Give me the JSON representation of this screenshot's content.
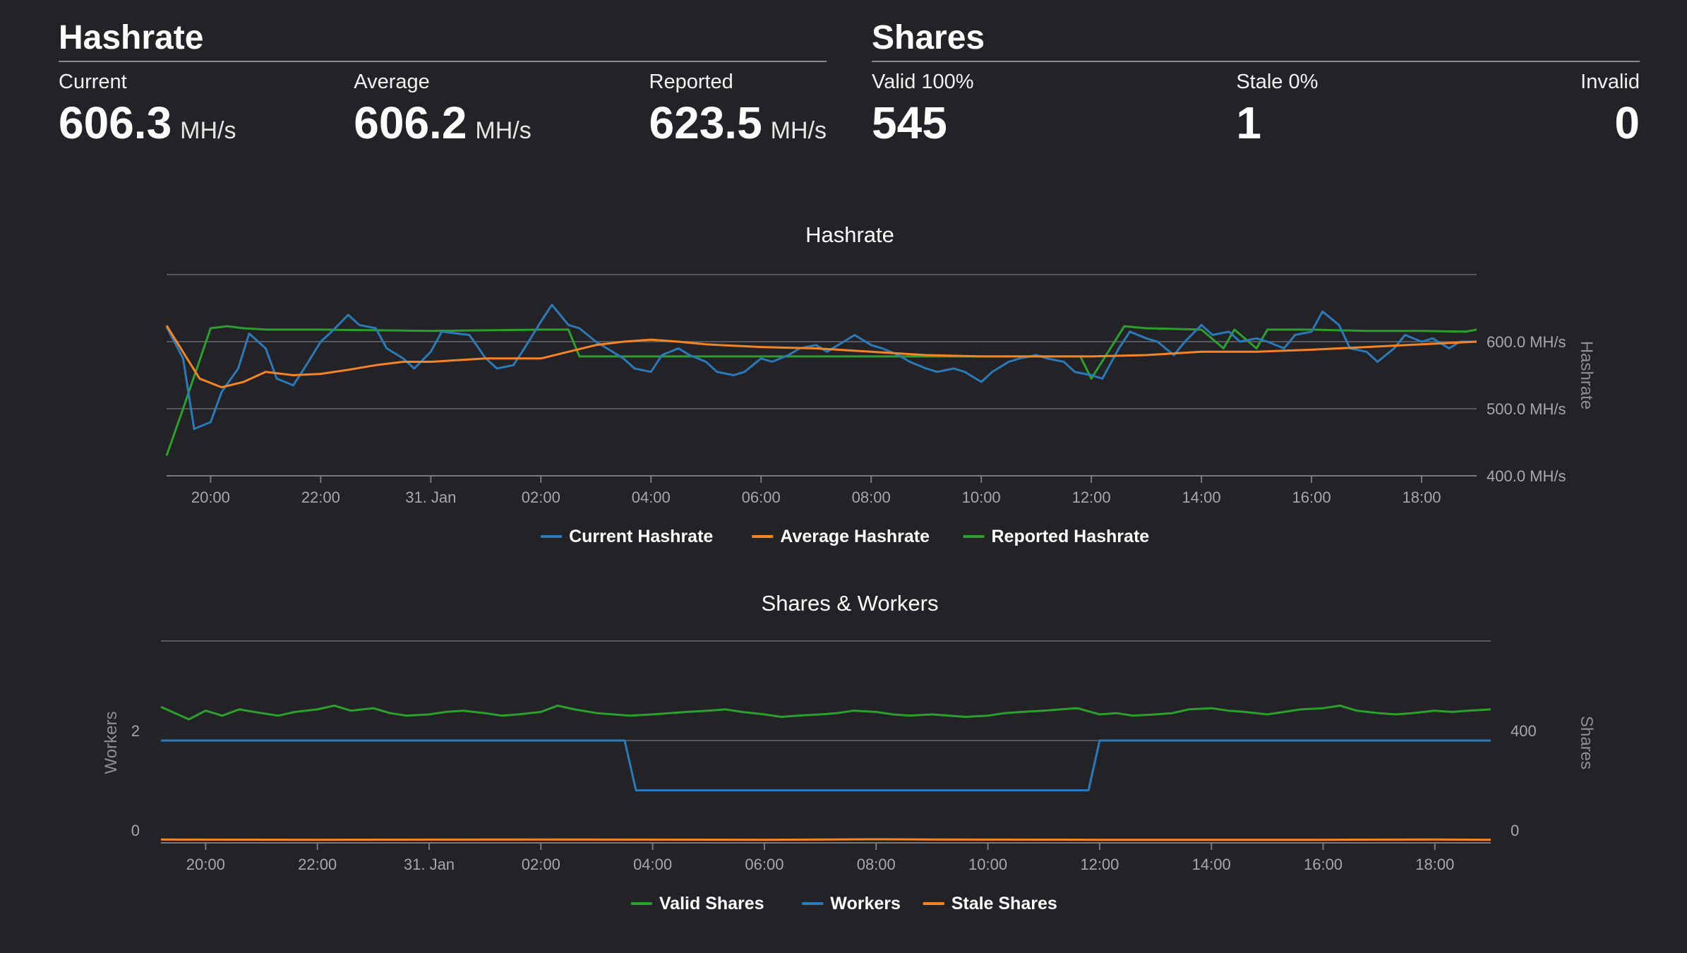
{
  "hashrate": {
    "title": "Hashrate",
    "current": {
      "label": "Current",
      "value": "606.3",
      "unit": "MH/s"
    },
    "average": {
      "label": "Average",
      "value": "606.2",
      "unit": "MH/s"
    },
    "reported": {
      "label": "Reported",
      "value": "623.5",
      "unit": "MH/s"
    }
  },
  "shares": {
    "title": "Shares",
    "valid": {
      "label": "Valid 100%",
      "value": "545"
    },
    "stale": {
      "label": "Stale 0%",
      "value": "1"
    },
    "invalid": {
      "label": "Invalid",
      "value": "0"
    }
  },
  "colors": {
    "blue": "#2a7ab9",
    "orange": "#f58422",
    "green": "#2ca02c"
  },
  "chart_data": [
    {
      "type": "line",
      "title": "Hashrate",
      "ylabel": "Hashrate",
      "ylim": [
        400,
        700
      ],
      "yticks": [
        "400.0 MH/s",
        "500.0 MH/s",
        "600.0 MH/s"
      ],
      "x_tick_labels": [
        "20:00",
        "22:00",
        "31. Jan",
        "02:00",
        "04:00",
        "06:00",
        "08:00",
        "10:00",
        "12:00",
        "14:00",
        "16:00",
        "18:00"
      ],
      "x_range_hours": [
        19.2,
        43.0
      ],
      "grid": true,
      "legend_position": "bottom",
      "series": [
        {
          "name": "Current Hashrate",
          "color": "#2a7ab9",
          "x": [
            19.2,
            19.5,
            19.7,
            20.0,
            20.2,
            20.5,
            20.7,
            21.0,
            21.2,
            21.5,
            21.7,
            22.0,
            22.2,
            22.5,
            22.7,
            23.0,
            23.2,
            23.5,
            23.7,
            24.0,
            24.2,
            24.5,
            24.7,
            25.0,
            25.2,
            25.5,
            25.7,
            26.0,
            26.2,
            26.5,
            26.7,
            27.0,
            27.2,
            27.5,
            27.7,
            28.0,
            28.2,
            28.5,
            28.7,
            29.0,
            29.2,
            29.5,
            29.7,
            30.0,
            30.2,
            30.5,
            30.7,
            31.0,
            31.2,
            31.5,
            31.7,
            32.0,
            32.2,
            32.5,
            32.7,
            33.0,
            33.2,
            33.5,
            33.7,
            34.0,
            34.2,
            34.5,
            34.7,
            35.0,
            35.2,
            35.5,
            35.7,
            36.0,
            36.2,
            36.5,
            36.7,
            37.0,
            37.2,
            37.5,
            37.7,
            38.0,
            38.2,
            38.5,
            38.7,
            39.0,
            39.2,
            39.5,
            39.7,
            40.0,
            40.2,
            40.5,
            40.7,
            41.0,
            41.2,
            41.5,
            41.7,
            42.0,
            42.2,
            42.5,
            42.7,
            43.0
          ],
          "y": [
            622,
            575,
            470,
            480,
            525,
            560,
            612,
            590,
            545,
            535,
            560,
            600,
            615,
            640,
            625,
            620,
            590,
            575,
            560,
            585,
            615,
            612,
            610,
            575,
            560,
            565,
            590,
            630,
            655,
            625,
            620,
            600,
            590,
            575,
            560,
            555,
            580,
            590,
            580,
            570,
            555,
            550,
            555,
            575,
            570,
            580,
            590,
            595,
            585,
            600,
            610,
            595,
            590,
            580,
            570,
            560,
            555,
            560,
            555,
            540,
            555,
            570,
            575,
            580,
            575,
            570,
            555,
            550,
            545,
            590,
            615,
            605,
            600,
            580,
            600,
            625,
            610,
            615,
            600,
            605,
            600,
            590,
            610,
            615,
            645,
            625,
            590,
            585,
            570,
            590,
            610,
            600,
            605,
            590,
            600,
            600
          ],
          "note_unused": ""
        },
        {
          "name": "Average Hashrate",
          "color": "#f58422",
          "x": [
            19.2,
            19.8,
            20.2,
            20.6,
            21.0,
            21.5,
            22.0,
            22.5,
            23.0,
            23.5,
            24.0,
            25.0,
            26.0,
            26.5,
            27.0,
            27.5,
            28.0,
            28.5,
            29.0,
            30.0,
            31.0,
            32.0,
            33.0,
            34.0,
            35.0,
            36.0,
            37.0,
            38.0,
            39.0,
            40.0,
            41.0,
            42.0,
            43.0
          ],
          "y": [
            624,
            545,
            532,
            540,
            555,
            550,
            552,
            558,
            565,
            570,
            570,
            575,
            575,
            585,
            595,
            600,
            603,
            600,
            596,
            592,
            590,
            585,
            580,
            578,
            578,
            578,
            580,
            585,
            585,
            588,
            592,
            596,
            600
          ]
        },
        {
          "name": "Reported Hashrate",
          "color": "#2ca02c",
          "x": [
            19.2,
            19.5,
            20.0,
            20.3,
            20.6,
            21.0,
            22.0,
            24.0,
            26.0,
            26.5,
            26.7,
            28.0,
            30.0,
            32.0,
            35.0,
            35.8,
            36.0,
            36.6,
            37.0,
            38.0,
            38.4,
            38.6,
            39.0,
            39.2,
            39.5,
            40.0,
            41.0,
            42.0,
            42.8,
            43.0
          ],
          "y": [
            430,
            500,
            620,
            623,
            620,
            618,
            618,
            616,
            618,
            618,
            578,
            578,
            578,
            578,
            578,
            578,
            545,
            623,
            620,
            618,
            590,
            618,
            590,
            618,
            618,
            618,
            616,
            616,
            615,
            618
          ]
        }
      ]
    },
    {
      "type": "line",
      "title": "Shares & Workers",
      "ylabel_left": "Workers",
      "ylabel_right": "Shares",
      "yticks_left": [
        "0",
        "2"
      ],
      "yticks_right": [
        "0",
        "400"
      ],
      "x_tick_labels": [
        "20:00",
        "22:00",
        "31. Jan",
        "02:00",
        "04:00",
        "06:00",
        "08:00",
        "10:00",
        "12:00",
        "14:00",
        "16:00",
        "18:00"
      ],
      "x_range_hours": [
        19.2,
        43.0
      ],
      "grid": true,
      "legend_position": "bottom",
      "series": [
        {
          "name": "Valid Shares",
          "color": "#2ca02c",
          "axis": "right",
          "x": [
            19.2,
            19.7,
            20.0,
            20.3,
            20.6,
            21.0,
            21.3,
            21.6,
            22.0,
            22.3,
            22.6,
            23.0,
            23.3,
            23.6,
            24.0,
            24.3,
            24.6,
            25.0,
            25.3,
            25.6,
            26.0,
            26.3,
            26.6,
            27.0,
            27.3,
            27.6,
            28.0,
            28.3,
            28.6,
            29.0,
            29.3,
            29.6,
            30.0,
            30.3,
            30.6,
            31.0,
            31.3,
            31.6,
            32.0,
            32.3,
            32.6,
            33.0,
            33.3,
            33.6,
            34.0,
            34.3,
            34.6,
            35.0,
            35.3,
            35.6,
            36.0,
            36.3,
            36.6,
            37.0,
            37.3,
            37.6,
            38.0,
            38.3,
            38.6,
            39.0,
            39.3,
            39.6,
            40.0,
            40.3,
            40.6,
            41.0,
            41.3,
            41.6,
            42.0,
            42.3,
            42.6,
            43.0
          ],
          "y": [
            535,
            485,
            520,
            500,
            525,
            510,
            500,
            515,
            525,
            540,
            520,
            530,
            510,
            500,
            505,
            515,
            520,
            510,
            500,
            505,
            515,
            540,
            525,
            510,
            505,
            500,
            505,
            510,
            515,
            520,
            525,
            515,
            505,
            495,
            500,
            505,
            510,
            520,
            515,
            505,
            500,
            505,
            500,
            495,
            500,
            510,
            515,
            520,
            525,
            530,
            505,
            510,
            500,
            505,
            510,
            525,
            530,
            520,
            515,
            505,
            515,
            525,
            530,
            540,
            520,
            510,
            505,
            510,
            520,
            515,
            520,
            525
          ],
          "note_unused": ""
        },
        {
          "name": "Workers",
          "color": "#2a7ab9",
          "axis": "left",
          "x": [
            19.2,
            27.5,
            27.7,
            35.8,
            36.0,
            43.0
          ],
          "y": [
            2,
            2,
            1,
            1,
            2,
            2
          ]
        },
        {
          "name": "Stale Shares",
          "color": "#f58422",
          "axis": "right",
          "x": [
            19.2,
            22.0,
            26.0,
            30.0,
            32.0,
            33.0,
            36.0,
            40.0,
            42.0,
            43.0
          ],
          "y": [
            2,
            1,
            2,
            1,
            3,
            2,
            1,
            1,
            2,
            1
          ]
        }
      ]
    }
  ]
}
